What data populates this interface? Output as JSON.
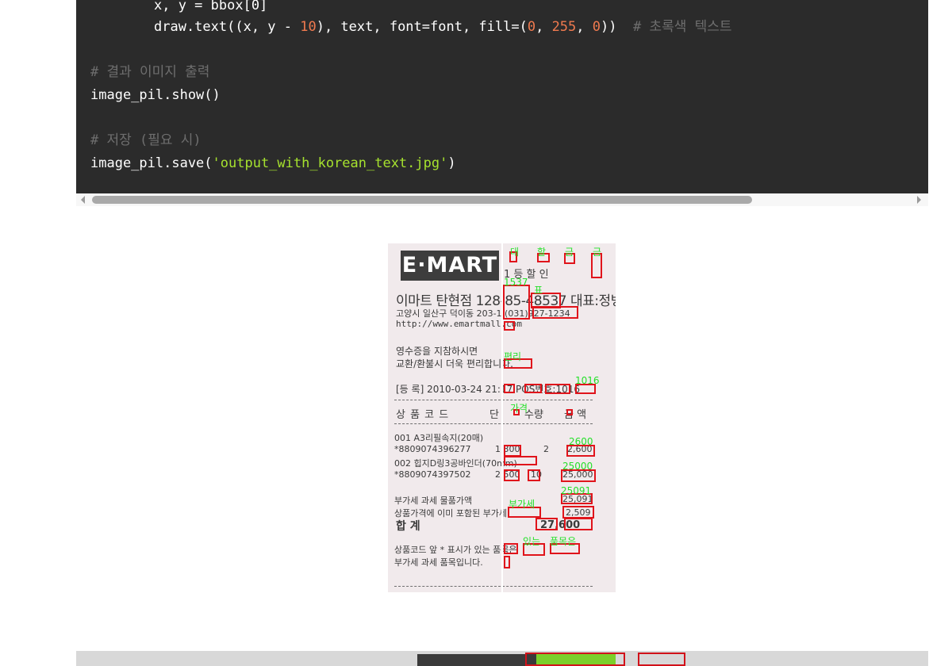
{
  "code": {
    "line1": "x, y = bbox[0]",
    "line2_code": "draw.text((x, y - ",
    "line2_num": "10",
    "line2_mid": "), text, font=font, fill=(",
    "line2_n1": "0",
    "line2_n2": "255",
    "line2_n3": "0",
    "line2_end": "))",
    "line2_comment": "# 초록색 텍스트",
    "comment1": "# 결과 이미지 출력",
    "line3": "image_pil.show()",
    "comment2": "# 저장 (필요 시)",
    "line4_pre": "image_pil.save(",
    "line4_str": "'output_with_korean_text.jpg'",
    "line4_post": ")"
  },
  "receipt": {
    "logo": "E·MART",
    "header_tag": "1 등 할 인",
    "store_line": "이마트 탄현점 128-85-48537 대표:정병렬",
    "address_line": "고양시 일산구 덕이동 203-1 (031)927-1234",
    "url": "http://www.emartmall.com",
    "notice1": "영수증을 지참하시면",
    "notice2": "교환/환불시 더욱 편리합니다.",
    "reg_line": "[등 록] 2010-03-24 21:17 POS번호:1016",
    "col_code": "상 품 코 드",
    "col_unit": "단",
    "col_qty": "수량",
    "col_amount": "금 액",
    "item1_name": "001   A3리필속지(20매)",
    "item1_code": "*8809074396277",
    "item1_price": "1,300",
    "item1_qty": "2",
    "item1_amount": "2,600",
    "item2_name": "002   힙지D링3공바인더(70mm)",
    "item2_code": "*8809074397502",
    "item2_price": "2,500",
    "item2_qty": "10",
    "item2_amount": "25,000",
    "tax_label": "부가세 과세 물품가액",
    "tax_value": "25,091",
    "vat_label": "상품가격에 이미 포함된 부가세",
    "vat_value": "2,509",
    "total_label": "합          계",
    "total_value": "27,600",
    "foot1": "상품코드 앞 * 표시가 있는 품목은",
    "foot2": "부가세 과세 품목입니다.",
    "ocr_labels": [
      "대",
      "할",
      "금",
      "금",
      "1537",
      "표",
      "번",
      "1016",
      "가격",
      "부가세",
      "2600",
      "25000",
      "25091",
      "부가세",
      "있는",
      "품목은",
      "편리"
    ]
  },
  "colors": {
    "code_bg": "#2b2b2b",
    "comment": "#6e6e6e",
    "number": "#f07a4f",
    "string": "#a6e22e",
    "box": "#e0141b",
    "ocr_text": "#25e02a"
  }
}
